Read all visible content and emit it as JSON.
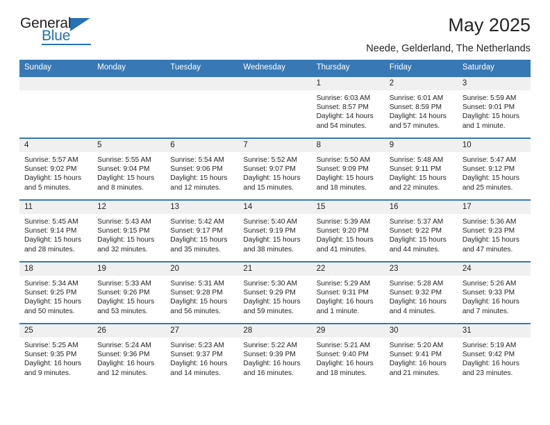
{
  "brand": {
    "name_top": "General",
    "name_bottom": "Blue",
    "accent_color": "#2572b6",
    "text_color": "#231f20"
  },
  "header": {
    "title": "May 2025",
    "subtitle": "Neede, Gelderland, The Netherlands"
  },
  "calendar": {
    "header_bg": "#3878b4",
    "header_text_color": "#ffffff",
    "daynum_band_bg": "#f0f0f0",
    "weekday_names": [
      "Sunday",
      "Monday",
      "Tuesday",
      "Wednesday",
      "Thursday",
      "Friday",
      "Saturday"
    ],
    "weeks": [
      [
        {
          "day": "",
          "sunrise": "",
          "sunset": "",
          "daylight": "",
          "empty": true
        },
        {
          "day": "",
          "sunrise": "",
          "sunset": "",
          "daylight": "",
          "empty": true
        },
        {
          "day": "",
          "sunrise": "",
          "sunset": "",
          "daylight": "",
          "empty": true
        },
        {
          "day": "",
          "sunrise": "",
          "sunset": "",
          "daylight": "",
          "empty": true
        },
        {
          "day": "1",
          "sunrise": "Sunrise: 6:03 AM",
          "sunset": "Sunset: 8:57 PM",
          "daylight": "Daylight: 14 hours and 54 minutes."
        },
        {
          "day": "2",
          "sunrise": "Sunrise: 6:01 AM",
          "sunset": "Sunset: 8:59 PM",
          "daylight": "Daylight: 14 hours and 57 minutes."
        },
        {
          "day": "3",
          "sunrise": "Sunrise: 5:59 AM",
          "sunset": "Sunset: 9:01 PM",
          "daylight": "Daylight: 15 hours and 1 minute."
        }
      ],
      [
        {
          "day": "4",
          "sunrise": "Sunrise: 5:57 AM",
          "sunset": "Sunset: 9:02 PM",
          "daylight": "Daylight: 15 hours and 5 minutes."
        },
        {
          "day": "5",
          "sunrise": "Sunrise: 5:55 AM",
          "sunset": "Sunset: 9:04 PM",
          "daylight": "Daylight: 15 hours and 8 minutes."
        },
        {
          "day": "6",
          "sunrise": "Sunrise: 5:54 AM",
          "sunset": "Sunset: 9:06 PM",
          "daylight": "Daylight: 15 hours and 12 minutes."
        },
        {
          "day": "7",
          "sunrise": "Sunrise: 5:52 AM",
          "sunset": "Sunset: 9:07 PM",
          "daylight": "Daylight: 15 hours and 15 minutes."
        },
        {
          "day": "8",
          "sunrise": "Sunrise: 5:50 AM",
          "sunset": "Sunset: 9:09 PM",
          "daylight": "Daylight: 15 hours and 18 minutes."
        },
        {
          "day": "9",
          "sunrise": "Sunrise: 5:48 AM",
          "sunset": "Sunset: 9:11 PM",
          "daylight": "Daylight: 15 hours and 22 minutes."
        },
        {
          "day": "10",
          "sunrise": "Sunrise: 5:47 AM",
          "sunset": "Sunset: 9:12 PM",
          "daylight": "Daylight: 15 hours and 25 minutes."
        }
      ],
      [
        {
          "day": "11",
          "sunrise": "Sunrise: 5:45 AM",
          "sunset": "Sunset: 9:14 PM",
          "daylight": "Daylight: 15 hours and 28 minutes."
        },
        {
          "day": "12",
          "sunrise": "Sunrise: 5:43 AM",
          "sunset": "Sunset: 9:15 PM",
          "daylight": "Daylight: 15 hours and 32 minutes."
        },
        {
          "day": "13",
          "sunrise": "Sunrise: 5:42 AM",
          "sunset": "Sunset: 9:17 PM",
          "daylight": "Daylight: 15 hours and 35 minutes."
        },
        {
          "day": "14",
          "sunrise": "Sunrise: 5:40 AM",
          "sunset": "Sunset: 9:19 PM",
          "daylight": "Daylight: 15 hours and 38 minutes."
        },
        {
          "day": "15",
          "sunrise": "Sunrise: 5:39 AM",
          "sunset": "Sunset: 9:20 PM",
          "daylight": "Daylight: 15 hours and 41 minutes."
        },
        {
          "day": "16",
          "sunrise": "Sunrise: 5:37 AM",
          "sunset": "Sunset: 9:22 PM",
          "daylight": "Daylight: 15 hours and 44 minutes."
        },
        {
          "day": "17",
          "sunrise": "Sunrise: 5:36 AM",
          "sunset": "Sunset: 9:23 PM",
          "daylight": "Daylight: 15 hours and 47 minutes."
        }
      ],
      [
        {
          "day": "18",
          "sunrise": "Sunrise: 5:34 AM",
          "sunset": "Sunset: 9:25 PM",
          "daylight": "Daylight: 15 hours and 50 minutes."
        },
        {
          "day": "19",
          "sunrise": "Sunrise: 5:33 AM",
          "sunset": "Sunset: 9:26 PM",
          "daylight": "Daylight: 15 hours and 53 minutes."
        },
        {
          "day": "20",
          "sunrise": "Sunrise: 5:31 AM",
          "sunset": "Sunset: 9:28 PM",
          "daylight": "Daylight: 15 hours and 56 minutes."
        },
        {
          "day": "21",
          "sunrise": "Sunrise: 5:30 AM",
          "sunset": "Sunset: 9:29 PM",
          "daylight": "Daylight: 15 hours and 59 minutes."
        },
        {
          "day": "22",
          "sunrise": "Sunrise: 5:29 AM",
          "sunset": "Sunset: 9:31 PM",
          "daylight": "Daylight: 16 hours and 1 minute."
        },
        {
          "day": "23",
          "sunrise": "Sunrise: 5:28 AM",
          "sunset": "Sunset: 9:32 PM",
          "daylight": "Daylight: 16 hours and 4 minutes."
        },
        {
          "day": "24",
          "sunrise": "Sunrise: 5:26 AM",
          "sunset": "Sunset: 9:33 PM",
          "daylight": "Daylight: 16 hours and 7 minutes."
        }
      ],
      [
        {
          "day": "25",
          "sunrise": "Sunrise: 5:25 AM",
          "sunset": "Sunset: 9:35 PM",
          "daylight": "Daylight: 16 hours and 9 minutes."
        },
        {
          "day": "26",
          "sunrise": "Sunrise: 5:24 AM",
          "sunset": "Sunset: 9:36 PM",
          "daylight": "Daylight: 16 hours and 12 minutes."
        },
        {
          "day": "27",
          "sunrise": "Sunrise: 5:23 AM",
          "sunset": "Sunset: 9:37 PM",
          "daylight": "Daylight: 16 hours and 14 minutes."
        },
        {
          "day": "28",
          "sunrise": "Sunrise: 5:22 AM",
          "sunset": "Sunset: 9:39 PM",
          "daylight": "Daylight: 16 hours and 16 minutes."
        },
        {
          "day": "29",
          "sunrise": "Sunrise: 5:21 AM",
          "sunset": "Sunset: 9:40 PM",
          "daylight": "Daylight: 16 hours and 18 minutes."
        },
        {
          "day": "30",
          "sunrise": "Sunrise: 5:20 AM",
          "sunset": "Sunset: 9:41 PM",
          "daylight": "Daylight: 16 hours and 21 minutes."
        },
        {
          "day": "31",
          "sunrise": "Sunrise: 5:19 AM",
          "sunset": "Sunset: 9:42 PM",
          "daylight": "Daylight: 16 hours and 23 minutes."
        }
      ]
    ]
  }
}
